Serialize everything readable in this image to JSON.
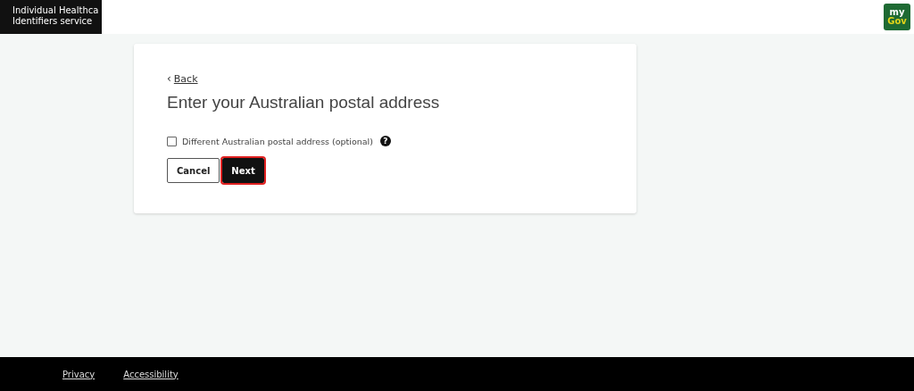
{
  "header": {
    "service_name_lines": [
      "Individual Healthca",
      "Identifiers service"
    ],
    "logo": {
      "line_1": "my",
      "line_2": "Gov"
    }
  },
  "card": {
    "back_link": "Back",
    "back_icon": "‹",
    "heading": "Enter your Australian postal address",
    "checkbox": {
      "label": "Different Australian postal address (optional)",
      "checked": false,
      "help_icon": "?"
    },
    "buttons": [
      {
        "kind": "secondary",
        "label": "Cancel",
        "focused": false
      },
      {
        "kind": "primary",
        "label": "Next",
        "focused": true
      }
    ]
  },
  "footer": {
    "links": [
      "Privacy",
      "Accessibility"
    ]
  }
}
